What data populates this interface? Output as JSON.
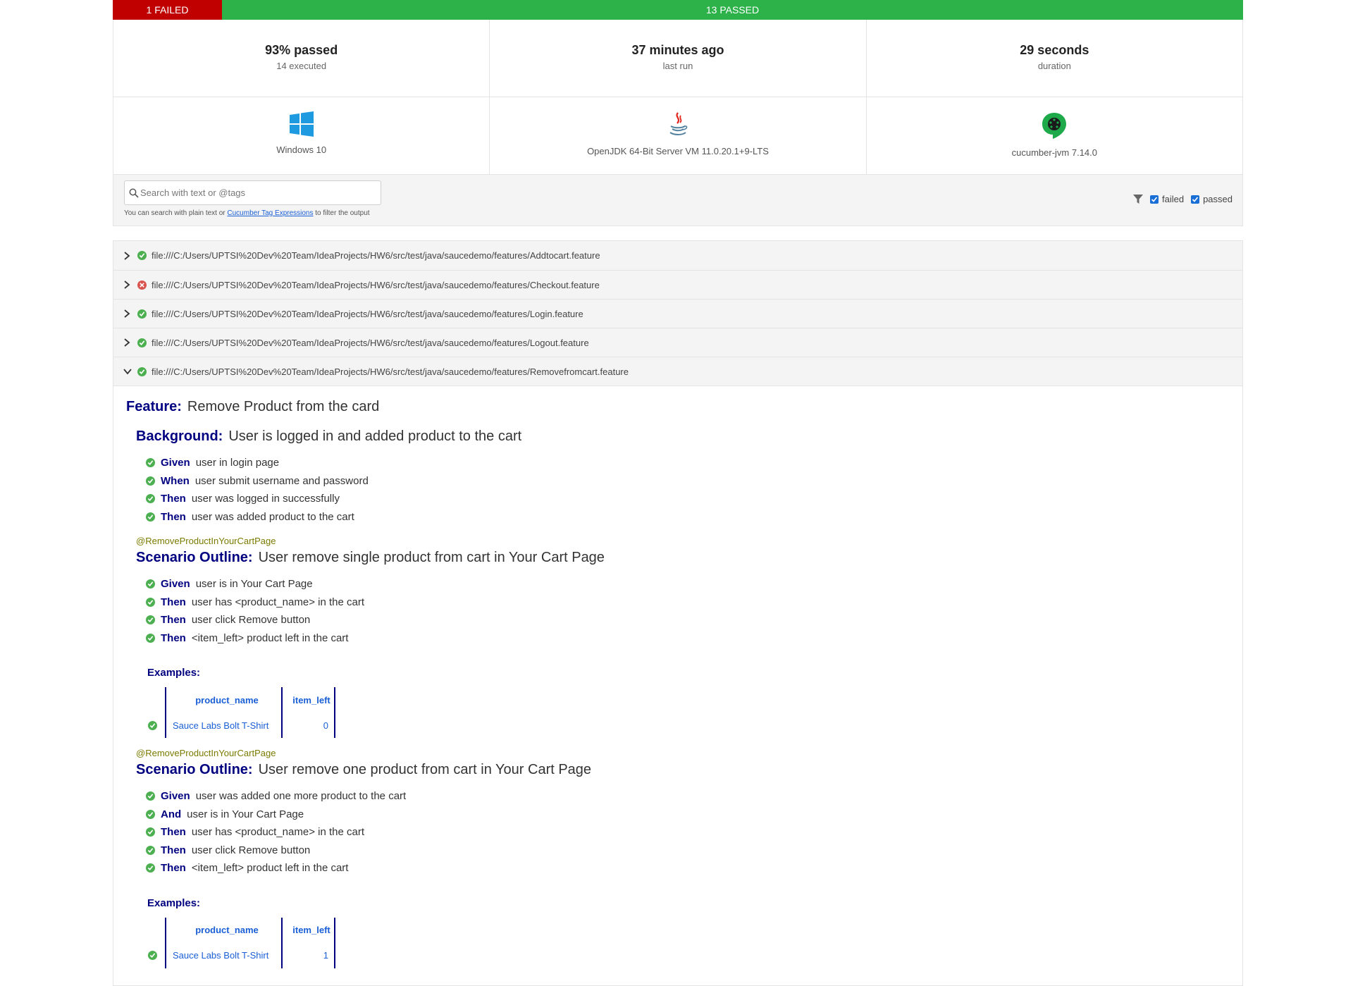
{
  "statusbar": {
    "failed": "1 FAILED",
    "passed": "13 PASSED"
  },
  "summary": {
    "passed_pct": "93% passed",
    "executed": "14 executed",
    "last_run": "37 minutes ago",
    "last_run_label": "last run",
    "duration": "29 seconds",
    "duration_label": "duration"
  },
  "env": {
    "os": "Windows 10",
    "jvm": "OpenJDK 64-Bit Server VM 11.0.20.1+9-LTS",
    "tool": "cucumber-jvm 7.14.0"
  },
  "search": {
    "placeholder": "Search with text or @tags",
    "hint_prefix": "You can search with plain text or ",
    "hint_link": "Cucumber Tag Expressions",
    "hint_suffix": " to filter the output",
    "filter_failed": "failed",
    "filter_passed": "passed"
  },
  "features": [
    {
      "path": "file:///C:/Users/UPTSI%20Dev%20Team/IdeaProjects/HW6/src/test/java/saucedemo/features/Addtocart.feature",
      "status": "passed"
    },
    {
      "path": "file:///C:/Users/UPTSI%20Dev%20Team/IdeaProjects/HW6/src/test/java/saucedemo/features/Checkout.feature",
      "status": "failed"
    },
    {
      "path": "file:///C:/Users/UPTSI%20Dev%20Team/IdeaProjects/HW6/src/test/java/saucedemo/features/Login.feature",
      "status": "passed"
    },
    {
      "path": "file:///C:/Users/UPTSI%20Dev%20Team/IdeaProjects/HW6/src/test/java/saucedemo/features/Logout.feature",
      "status": "passed"
    },
    {
      "path": "file:///C:/Users/UPTSI%20Dev%20Team/IdeaProjects/HW6/src/test/java/saucedemo/features/Removefromcart.feature",
      "status": "passed"
    }
  ],
  "detail": {
    "feature_kw": "Feature:",
    "feature_name": "Remove Product from the card",
    "background_kw": "Background:",
    "background_name": "User is logged in and added product to the cart",
    "background_steps": [
      {
        "kw": "Given",
        "text": "user in login page"
      },
      {
        "kw": "When",
        "text": "user submit username and password"
      },
      {
        "kw": "Then",
        "text": "user was logged in successfully"
      },
      {
        "kw": "Then",
        "text": "user was added product to the cart"
      }
    ],
    "scenarios": [
      {
        "tag": "@RemoveProductInYourCartPage",
        "kw": "Scenario Outline:",
        "name": "User remove single product from cart in Your Cart Page",
        "steps": [
          {
            "kw": "Given",
            "text": "user is in Your Cart Page"
          },
          {
            "kw": "Then",
            "text": "user has <product_name> in the cart"
          },
          {
            "kw": "Then",
            "text": "user click Remove button"
          },
          {
            "kw": "Then",
            "text": "<item_left> product left in the cart"
          }
        ],
        "examples_kw": "Examples:",
        "headers": [
          "product_name",
          "item_left"
        ],
        "rows": [
          [
            "Sauce Labs Bolt T-Shirt",
            "0"
          ]
        ]
      },
      {
        "tag": "@RemoveProductInYourCartPage",
        "kw": "Scenario Outline:",
        "name": "User remove one product from cart in Your Cart Page",
        "steps": [
          {
            "kw": "Given",
            "text": "user was added one more product to the cart"
          },
          {
            "kw": "And",
            "text": "user is in Your Cart Page"
          },
          {
            "kw": "Then",
            "text": "user has <product_name> in the cart"
          },
          {
            "kw": "Then",
            "text": "user click Remove button"
          },
          {
            "kw": "Then",
            "text": "<item_left> product left in the cart"
          }
        ],
        "examples_kw": "Examples:",
        "headers": [
          "product_name",
          "item_left"
        ],
        "rows": [
          [
            "Sauce Labs Bolt T-Shirt",
            "1"
          ]
        ]
      }
    ]
  },
  "colors": {
    "failed": "#c00000",
    "passed": "#2db24a",
    "keyword": "#000080",
    "link": "#1a5fd6"
  }
}
